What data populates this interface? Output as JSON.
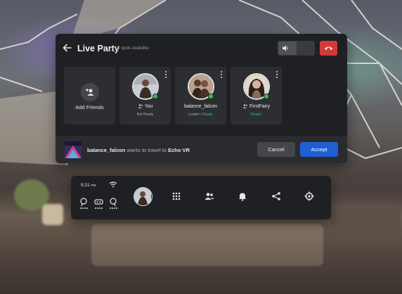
{
  "party": {
    "title": "Live Party",
    "spots": "5 spots available",
    "add_friends": "Add Friends",
    "members": [
      {
        "name": "You",
        "status": "Not Ready",
        "ready_text": ""
      },
      {
        "name": "balance_falcon",
        "status": "Leader • ",
        "ready_text": "Ready"
      },
      {
        "name": "FirstFairy",
        "status": "",
        "ready_text": "Ready"
      }
    ]
  },
  "invite": {
    "user": "balance_falcon",
    "message": " wants to travel to ",
    "destination": "Echo VR",
    "cancel_label": "Cancel",
    "accept_label": "Accept"
  },
  "menubar": {
    "time": "5:21",
    "ampm": "PM"
  },
  "icons": [
    "back-arrow-icon",
    "volume-icon",
    "hang-up-icon",
    "add-person-icon",
    "kebab-icon",
    "people-icon",
    "wifi-icon",
    "controller-icon",
    "headset-icon",
    "apps-grid-icon",
    "bell-icon",
    "share-icon",
    "settings-gear-icon"
  ],
  "colors": {
    "panel": "#1f2023",
    "card": "#2d2e32",
    "accent_blue": "#1f5fd1",
    "danger_red": "#d23a3a",
    "online_green": "#2fbf59"
  }
}
